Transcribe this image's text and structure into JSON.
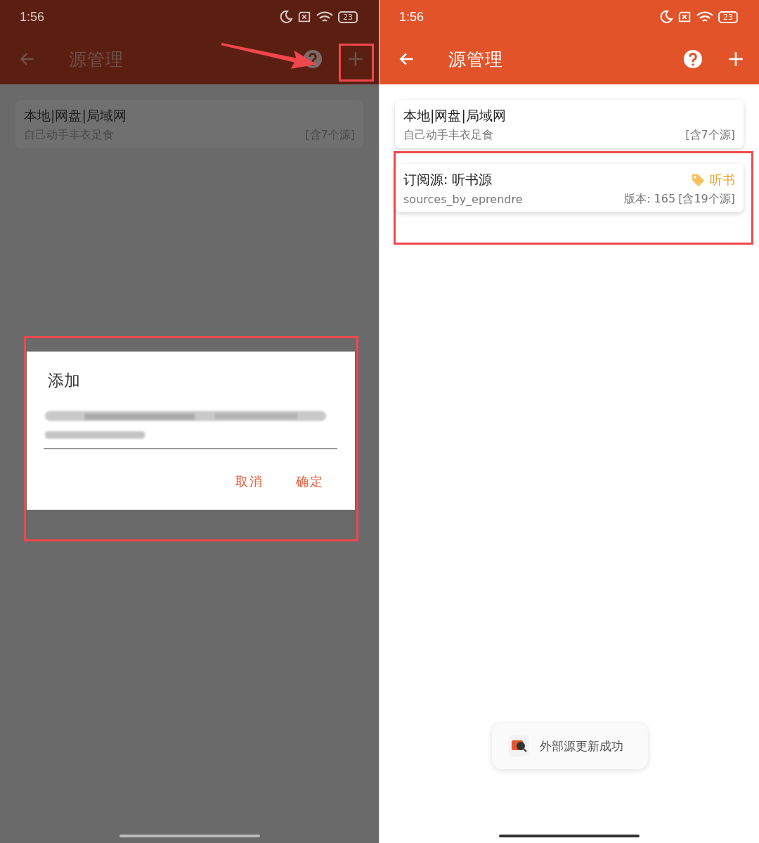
{
  "screens": [
    {
      "dimmed": true,
      "status_bar": {
        "time": "1:56",
        "battery": "23"
      },
      "app_bar": {
        "title": "源管理",
        "add_marked": true
      },
      "sources": [
        {
          "title": "本地|网盘|局域网",
          "subtitle": "自己动手丰衣足食",
          "count": "[含7个源]",
          "marked": false
        }
      ],
      "dialog": {
        "title": "添加",
        "marked": true,
        "buttons": [
          "取消",
          "确定"
        ]
      }
    },
    {
      "dimmed": false,
      "status_bar": {
        "time": "1:56",
        "battery": "23"
      },
      "app_bar": {
        "title": "源管理",
        "add_marked": false
      },
      "sources": [
        {
          "title": "本地|网盘|局域网",
          "subtitle": "自己动手丰衣足食",
          "count": "[含7个源]",
          "marked": false
        },
        {
          "title": "订阅源: 听书源",
          "subtitle": "sources_by_eprendre",
          "tag": "听书",
          "version": "版本: 165",
          "count": "[含19个源]",
          "marked": true
        }
      ],
      "toast": {
        "text": "外部源更新成功"
      }
    }
  ]
}
